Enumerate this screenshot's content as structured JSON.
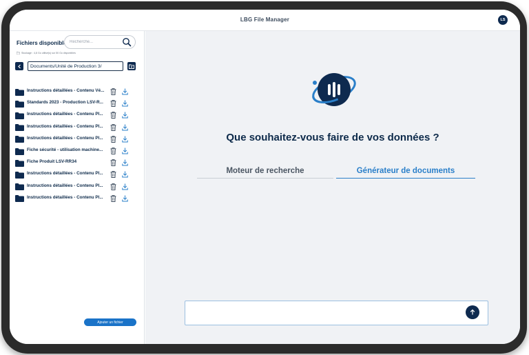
{
  "app": {
    "title": "LBG File Manager",
    "user_initials": "LS"
  },
  "sidebar": {
    "title": "Fichiers disponibles",
    "search_placeholder": "Recherche...",
    "storage_text": "Stockage : 4,8 Go utilisé(s) sur 50 Go disponibles",
    "current_path": "Documents/Unité de Production 3/",
    "files": [
      {
        "name": "Instructions détaillées - Contenu Vé..."
      },
      {
        "name": "Standards 2023 - Production LSV-R..."
      },
      {
        "name": "Instructions détaillées - Contenu Pl..."
      },
      {
        "name": "Instructions détaillées - Contenu Pl..."
      },
      {
        "name": "Instructions détaillées - Contenu Pl..."
      },
      {
        "name": "Fiche sécurité - utilisation machine..."
      },
      {
        "name": "Fiche Produit LSV-RR34"
      },
      {
        "name": "Instructions détaillées - Contenu Pl..."
      },
      {
        "name": "Instructions détaillées - Contenu Pl..."
      },
      {
        "name": "Instructions détaillées - Contenu Pl..."
      }
    ],
    "add_file_label": "Ajouter un fichier"
  },
  "main": {
    "question": "Que souhaitez-vous faire de vos données ?",
    "tabs": [
      {
        "label": "Moteur de recherche",
        "active": false
      },
      {
        "label": "Générateur de documents",
        "active": true
      }
    ],
    "chat_placeholder": ""
  },
  "colors": {
    "navy": "#0e2a4f",
    "accent_blue": "#2a7fc9",
    "button_blue": "#1a73c8",
    "main_bg": "#f0f2f5"
  },
  "icons": {
    "search": "search-icon",
    "folder": "folder-icon",
    "trash": "trash-icon",
    "download": "download-icon",
    "back": "chevron-left-icon",
    "new_folder": "folder-plus-icon",
    "send": "arrow-up-icon"
  }
}
